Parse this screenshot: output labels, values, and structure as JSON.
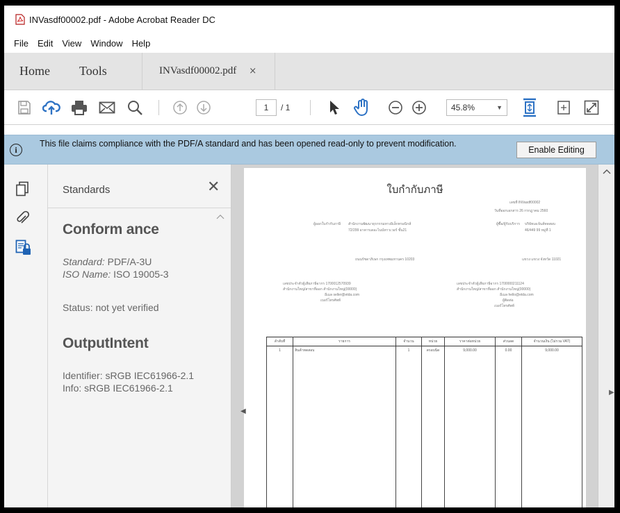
{
  "window": {
    "title": "INVasdf00002.pdf - Adobe Acrobat Reader DC"
  },
  "menu": {
    "items": [
      "File",
      "Edit",
      "View",
      "Window",
      "Help"
    ]
  },
  "tabs": {
    "home": "Home",
    "tools": "Tools",
    "document": "INVasdf00002.pdf",
    "close": "×"
  },
  "toolbar": {
    "icons": [
      "save-icon",
      "upload-cloud-icon",
      "print-icon",
      "email-icon",
      "search-icon",
      "previous-page-icon",
      "next-page-icon",
      "select-pointer-icon",
      "hand-tool-icon",
      "zoom-out-icon",
      "zoom-in-icon",
      "fit-page-icon",
      "rotate-icon",
      "full-screen-icon"
    ],
    "page_current": "1",
    "page_total": "/ 1",
    "zoom": "45.8%"
  },
  "notification": {
    "message": "This file claims compliance with the PDF/A standard and has been opened read-only to prevent modification.",
    "button": "Enable Editing"
  },
  "panel": {
    "title": "Standards",
    "close": "✕",
    "conformance_heading": "Conform ance",
    "standard_label": "Standard:",
    "standard_value": "PDF/A-3U",
    "iso_label": "ISO Name:",
    "iso_value": "ISO 19005-3",
    "status": "Status:  not yet verified",
    "output_heading": "OutputIntent",
    "identifier": "Identifier:  sRGB IEC61966-2.1",
    "info": "Info:  sRGB IEC61966-2.1"
  },
  "invoice": {
    "title": "ใบกำกับภาษี",
    "meta": [
      "เลขที่  INVasdf00002",
      "วันที่ออกเอกสาร  26 กรกฎาคม 2560"
    ],
    "seller_label": "ผู้ออกใบกำกับภาษี",
    "seller_name": "สำนักงานพัฒนาธุรกรรมทางอิเล็กทรอนิกส์",
    "seller_addr": "72/299  อาคารเดอะไนน์ทาวเวอร์ ชั้น21",
    "seller_addr2": "ถนนรัชดาภิเษก กรุงเทพมหานคร 10203",
    "buyer_label": "ผู้ซื้อ/ผู้รับบริการ",
    "buyer_name": "บริษัทเอเจ้นส์ทดสอบ",
    "buyer_addr": "46/449  99  หมู่ที่ 1",
    "buyer_addr2": "แขวง แขวง จังหวัด 11021",
    "seller_tax": [
      "เลขประจำตัวผู้เสียภาษีอากร  1700012570939",
      "สำนักงานใหญ่/สาขาที่ออก  สำนักงานใหญ่(00000)",
      "อีเมล  seller@etda.com",
      "เบอร์โทรศัพท์"
    ],
    "buyer_tax": [
      "เลขประจำตัวผู้เสียภาษีอากร  1700000211124",
      "สำนักงานใหญ่/สาขาที่ออก  สำนักงานใหญ่(00000)",
      "อีเมล  hello@etda.com",
      "ผู้ติดต่อ",
      "เบอร์โทรศัพท์"
    ],
    "columns": [
      "ลำดับที่",
      "รายการ",
      "จำนวน",
      "หน่วย",
      "ราคาต่อหน่วย",
      "ส่วนลด",
      "จำนวนเงิน (ไม่รวม VAT)"
    ],
    "rows": [
      [
        "1",
        "สินค้าทดสอบ",
        "1",
        "ครอบนิด",
        "9,000.00",
        "0.00",
        "9,000.00"
      ]
    ]
  }
}
